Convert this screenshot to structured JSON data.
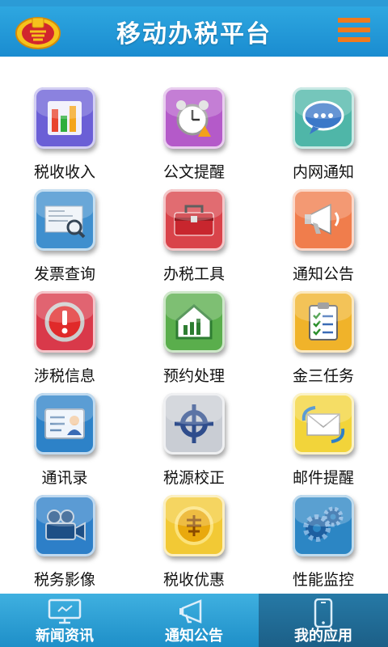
{
  "header": {
    "title": "移动办税平台"
  },
  "apps": [
    {
      "label": "税收收入",
      "icon": "bar-chart-icon",
      "color": "#6b5fd6"
    },
    {
      "label": "公文提醒",
      "icon": "alarm-clock-icon",
      "color": "#b45ac9"
    },
    {
      "label": "内网通知",
      "icon": "chat-bubble-icon",
      "color": "#4fb6a8"
    },
    {
      "label": "发票查询",
      "icon": "invoice-search-icon",
      "color": "#3f8fce"
    },
    {
      "label": "办税工具",
      "icon": "toolbox-icon",
      "color": "#d9434a"
    },
    {
      "label": "通知公告",
      "icon": "megaphone-icon",
      "color": "#f07d4c"
    },
    {
      "label": "涉税信息",
      "icon": "alert-icon",
      "color": "#d9394a"
    },
    {
      "label": "预约处理",
      "icon": "house-chart-icon",
      "color": "#5aae4c"
    },
    {
      "label": "金三任务",
      "icon": "clipboard-checklist-icon",
      "color": "#f0b32a"
    },
    {
      "label": "通讯录",
      "icon": "contact-card-icon",
      "color": "#2d82c8"
    },
    {
      "label": "税源校正",
      "icon": "crosshair-icon",
      "color": "#c9cdd4"
    },
    {
      "label": "邮件提醒",
      "icon": "mail-icon",
      "color": "#f2d43a"
    },
    {
      "label": "税务影像",
      "icon": "camera-icon",
      "color": "#2d7fc8"
    },
    {
      "label": "税收优惠",
      "icon": "discount-coin-icon",
      "color": "#f2c935"
    },
    {
      "label": "性能监控",
      "icon": "gears-icon",
      "color": "#2c86c4"
    }
  ],
  "tabs": [
    {
      "label": "新闻资讯",
      "icon": "monitor-icon",
      "active": false
    },
    {
      "label": "通知公告",
      "icon": "megaphone-icon",
      "active": false
    },
    {
      "label": "我的应用",
      "icon": "phone-icon",
      "active": true
    }
  ]
}
